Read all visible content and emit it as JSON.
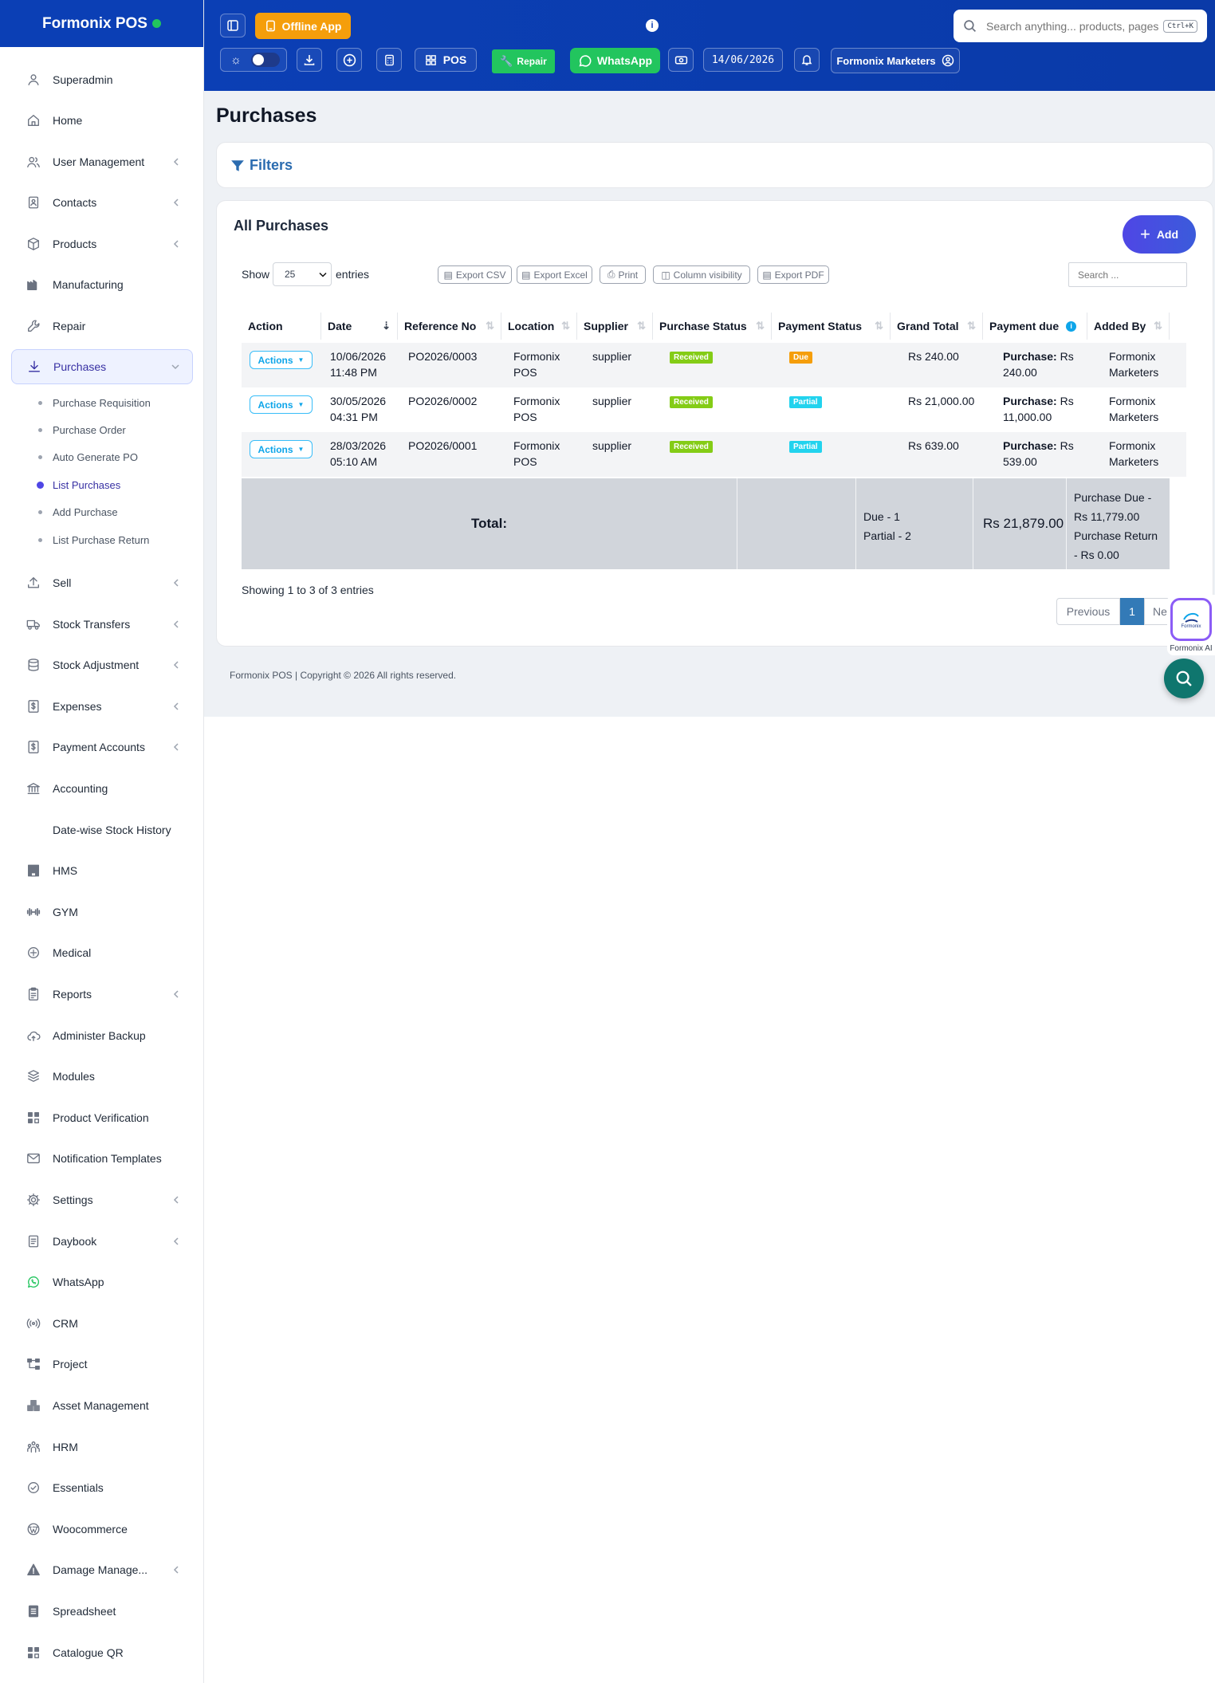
{
  "brand": {
    "name": "Formonix POS"
  },
  "sidebar": {
    "items": [
      {
        "label": "Superadmin",
        "icon": "user-icon",
        "chevron": false
      },
      {
        "label": "Home",
        "icon": "home-icon",
        "chevron": false
      },
      {
        "label": "User Management",
        "icon": "users-icon",
        "chevron": true
      },
      {
        "label": "Contacts",
        "icon": "contacts-icon",
        "chevron": true
      },
      {
        "label": "Products",
        "icon": "box-icon",
        "chevron": true
      },
      {
        "label": "Manufacturing",
        "icon": "factory-icon",
        "chevron": false
      },
      {
        "label": "Repair",
        "icon": "wrench-icon",
        "chevron": false
      },
      {
        "label": "Purchases",
        "icon": "download-icon",
        "chevron": true,
        "active": true
      },
      {
        "label": "Sell",
        "icon": "upload-icon",
        "chevron": true
      },
      {
        "label": "Stock Transfers",
        "icon": "truck-icon",
        "chevron": true
      },
      {
        "label": "Stock Adjustment",
        "icon": "database-icon",
        "chevron": true
      },
      {
        "label": "Expenses",
        "icon": "dollar-icon",
        "chevron": true
      },
      {
        "label": "Payment Accounts",
        "icon": "receipt-icon",
        "chevron": true
      },
      {
        "label": "Accounting",
        "icon": "bank-icon",
        "chevron": false
      },
      {
        "label": "Date-wise Stock History",
        "icon": "",
        "chevron": false
      },
      {
        "label": "HMS",
        "icon": "hotel-icon",
        "chevron": false
      },
      {
        "label": "GYM",
        "icon": "dumbbell-icon",
        "chevron": false
      },
      {
        "label": "Medical",
        "icon": "medical-icon",
        "chevron": false
      },
      {
        "label": "Reports",
        "icon": "report-icon",
        "chevron": true
      },
      {
        "label": "Administer Backup",
        "icon": "cloud-icon",
        "chevron": false
      },
      {
        "label": "Modules",
        "icon": "modules-icon",
        "chevron": false
      },
      {
        "label": "Product Verification",
        "icon": "qr-icon",
        "chevron": false
      },
      {
        "label": "Notification Templates",
        "icon": "mail-icon",
        "chevron": false
      },
      {
        "label": "Settings",
        "icon": "gear-icon",
        "chevron": true
      },
      {
        "label": "Daybook",
        "icon": "book-icon",
        "chevron": true
      },
      {
        "label": "WhatsApp",
        "icon": "whatsapp-icon",
        "chevron": false
      },
      {
        "label": "CRM",
        "icon": "broadcast-icon",
        "chevron": false
      },
      {
        "label": "Project",
        "icon": "project-icon",
        "chevron": false
      },
      {
        "label": "Asset Management",
        "icon": "asset-icon",
        "chevron": false
      },
      {
        "label": "HRM",
        "icon": "people-icon",
        "chevron": false
      },
      {
        "label": "Essentials",
        "icon": "check-circle-icon",
        "chevron": false
      },
      {
        "label": "Woocommerce",
        "icon": "wordpress-icon",
        "chevron": false
      },
      {
        "label": "Damage Manage...",
        "icon": "warning-icon",
        "chevron": true
      },
      {
        "label": "Spreadsheet",
        "icon": "sheet-icon",
        "chevron": false
      },
      {
        "label": "Catalogue QR",
        "icon": "qr-icon",
        "chevron": false
      }
    ],
    "sub_items": [
      {
        "label": "Purchase Requisition"
      },
      {
        "label": "Purchase Order"
      },
      {
        "label": "Auto Generate PO"
      },
      {
        "label": "List Purchases",
        "active": true
      },
      {
        "label": "Add Purchase"
      },
      {
        "label": "List Purchase Return"
      }
    ]
  },
  "topbar": {
    "offline_app": "Offline App",
    "search_placeholder": "Search anything... products, pages",
    "search_shortcut": "Ctrl+K",
    "pos": "POS",
    "repair": "Repair",
    "whatsapp": "WhatsApp",
    "date": "14/06/2026",
    "business": "Formonix Marketers"
  },
  "page": {
    "title": "Purchases",
    "filters": "Filters",
    "card_title": "All Purchases",
    "add": "Add"
  },
  "table_controls": {
    "show": "Show",
    "entries_value": "25",
    "entries": "entries",
    "export_csv": "Export CSV",
    "export_excel": "Export Excel",
    "print": "Print",
    "column_visibility": "Column visibility",
    "export_pdf": "Export PDF",
    "search_placeholder": "Search ..."
  },
  "table": {
    "headers": [
      "Action",
      "Date",
      "Reference No",
      "Location",
      "Supplier",
      "Purchase Status",
      "Payment Status",
      "Grand Total",
      "Payment due",
      "Added By"
    ],
    "rows": [
      {
        "action": "Actions",
        "date1": "10/06/2026",
        "date2": "11:48 PM",
        "ref": "PO2026/0003",
        "loc1": "Formonix",
        "loc2": "POS",
        "supplier": "supplier",
        "status": "Received",
        "payment": "Due",
        "total": "Rs 240.00",
        "due_label": "Purchase:",
        "due1": "Rs",
        "due2": "240.00",
        "added1": "Formonix",
        "added2": "Marketers"
      },
      {
        "action": "Actions",
        "date1": "30/05/2026",
        "date2": "04:31 PM",
        "ref": "PO2026/0002",
        "loc1": "Formonix",
        "loc2": "POS",
        "supplier": "supplier",
        "status": "Received",
        "payment": "Partial",
        "total": "Rs 21,000.00",
        "due_label": "Purchase:",
        "due1": "Rs",
        "due2": "11,000.00",
        "added1": "Formonix",
        "added2": "Marketers"
      },
      {
        "action": "Actions",
        "date1": "28/03/2026",
        "date2": "05:10 AM",
        "ref": "PO2026/0001",
        "loc1": "Formonix",
        "loc2": "POS",
        "supplier": "supplier",
        "status": "Received",
        "payment": "Partial",
        "total": "Rs 639.00",
        "due_label": "Purchase:",
        "due1": "Rs",
        "due2": "539.00",
        "added1": "Formonix",
        "added2": "Marketers"
      }
    ],
    "total": {
      "label": "Total:",
      "status1": "Due - 1",
      "status2": "Partial - 2",
      "grand": "Rs 21,879.00",
      "due1": "Purchase Due -",
      "due2": "Rs 11,779.00",
      "due3": "Purchase Return",
      "due4": "- Rs 0.00"
    }
  },
  "pagination": {
    "info": "Showing 1 to 3 of 3 entries",
    "previous": "Previous",
    "page": "1",
    "next": "Next"
  },
  "ai": {
    "label": "Formonix AI",
    "logo_text": "Formonix"
  },
  "footer": {
    "text": "Formonix POS | Copyright © 2026 All rights reserved."
  },
  "colors": {
    "primary": "#0b3fb5",
    "offline": "#f59e0b",
    "repair": "#22c55e",
    "whatsapp": "#22c55e",
    "received": "#84cc16",
    "due": "#f59e0b",
    "partial": "#22d3ee",
    "accent": "#4f46e5",
    "fab": "#0f766e"
  }
}
